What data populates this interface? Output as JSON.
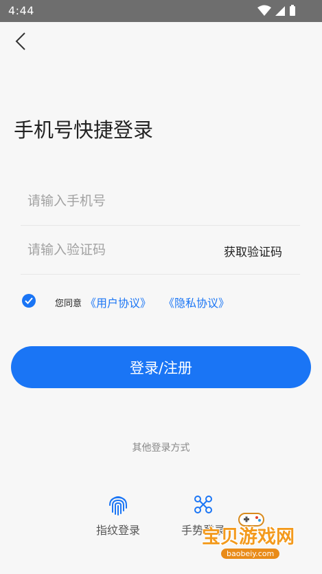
{
  "status_bar": {
    "time": "4:44"
  },
  "page": {
    "title": "手机号快捷登录"
  },
  "form": {
    "phone_placeholder": "请输入手机号",
    "code_placeholder": "请输入验证码",
    "get_code_label": "获取验证码"
  },
  "agreement": {
    "checked": true,
    "prefix": "您同意",
    "user_agreement": "《用户协议》",
    "privacy_policy": "《隐私协议》"
  },
  "login_button": {
    "label": "登录/注册"
  },
  "other_login": {
    "title": "其他登录方式",
    "options": [
      {
        "label": "指纹登录",
        "icon": "fingerprint-icon"
      },
      {
        "label": "手势登录",
        "icon": "gesture-pattern-icon"
      }
    ]
  },
  "watermark": {
    "brand": "宝贝游戏网",
    "url": "baobeiy.com"
  },
  "colors": {
    "accent": "#1a75f5",
    "status_bar": "#6e6e6e",
    "background": "#f7f7f7"
  }
}
